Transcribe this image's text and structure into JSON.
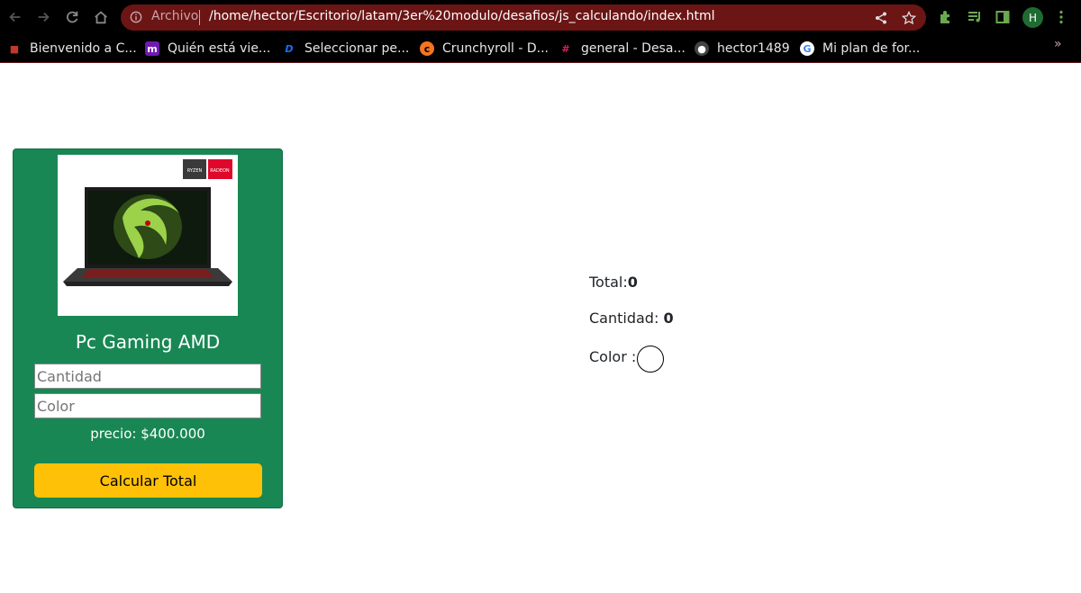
{
  "browser": {
    "omnibox": {
      "security_label": "Archivo",
      "url": "/home/hector/Escritorio/latam/3er%20modulo/desafios/js_calculando/index.html"
    },
    "profile_initial": "H",
    "bookmarks": [
      {
        "label": "Bienvenido a C...",
        "icon": "red-bookmark-icon",
        "color": "#c0392b"
      },
      {
        "label": "Quién está vie...",
        "icon": "m-logo-icon",
        "color": "#6f1ab1"
      },
      {
        "label": "Seleccionar pe...",
        "icon": "disney-logo-icon",
        "color": "#1f6bff"
      },
      {
        "label": "Crunchyroll - D...",
        "icon": "crunchyroll-icon",
        "color": "#f47521"
      },
      {
        "label": "general - Desa...",
        "icon": "slack-icon",
        "color": "#e01e5a"
      },
      {
        "label": "hector1489",
        "icon": "github-icon",
        "color": "#ffffff"
      },
      {
        "label": "Mi plan de for...",
        "icon": "google-icon",
        "color": "#4285f4"
      }
    ],
    "more_bookmarks": "»"
  },
  "product": {
    "title": "Pc Gaming AMD",
    "quantity_placeholder": "Cantidad",
    "color_placeholder": "Color",
    "price_text": "precio: $400.000",
    "button_label": "Calcular Total",
    "image_badges": [
      "RYZEN",
      "RADEON"
    ]
  },
  "results": {
    "total_label": "Total:",
    "total_value": "0",
    "quantity_label": "Cantidad: ",
    "quantity_value": "0",
    "color_label": "Color :"
  },
  "colors": {
    "card_bg": "#198754",
    "button_bg": "#ffc107",
    "omnibox_bg": "#6b1515"
  }
}
